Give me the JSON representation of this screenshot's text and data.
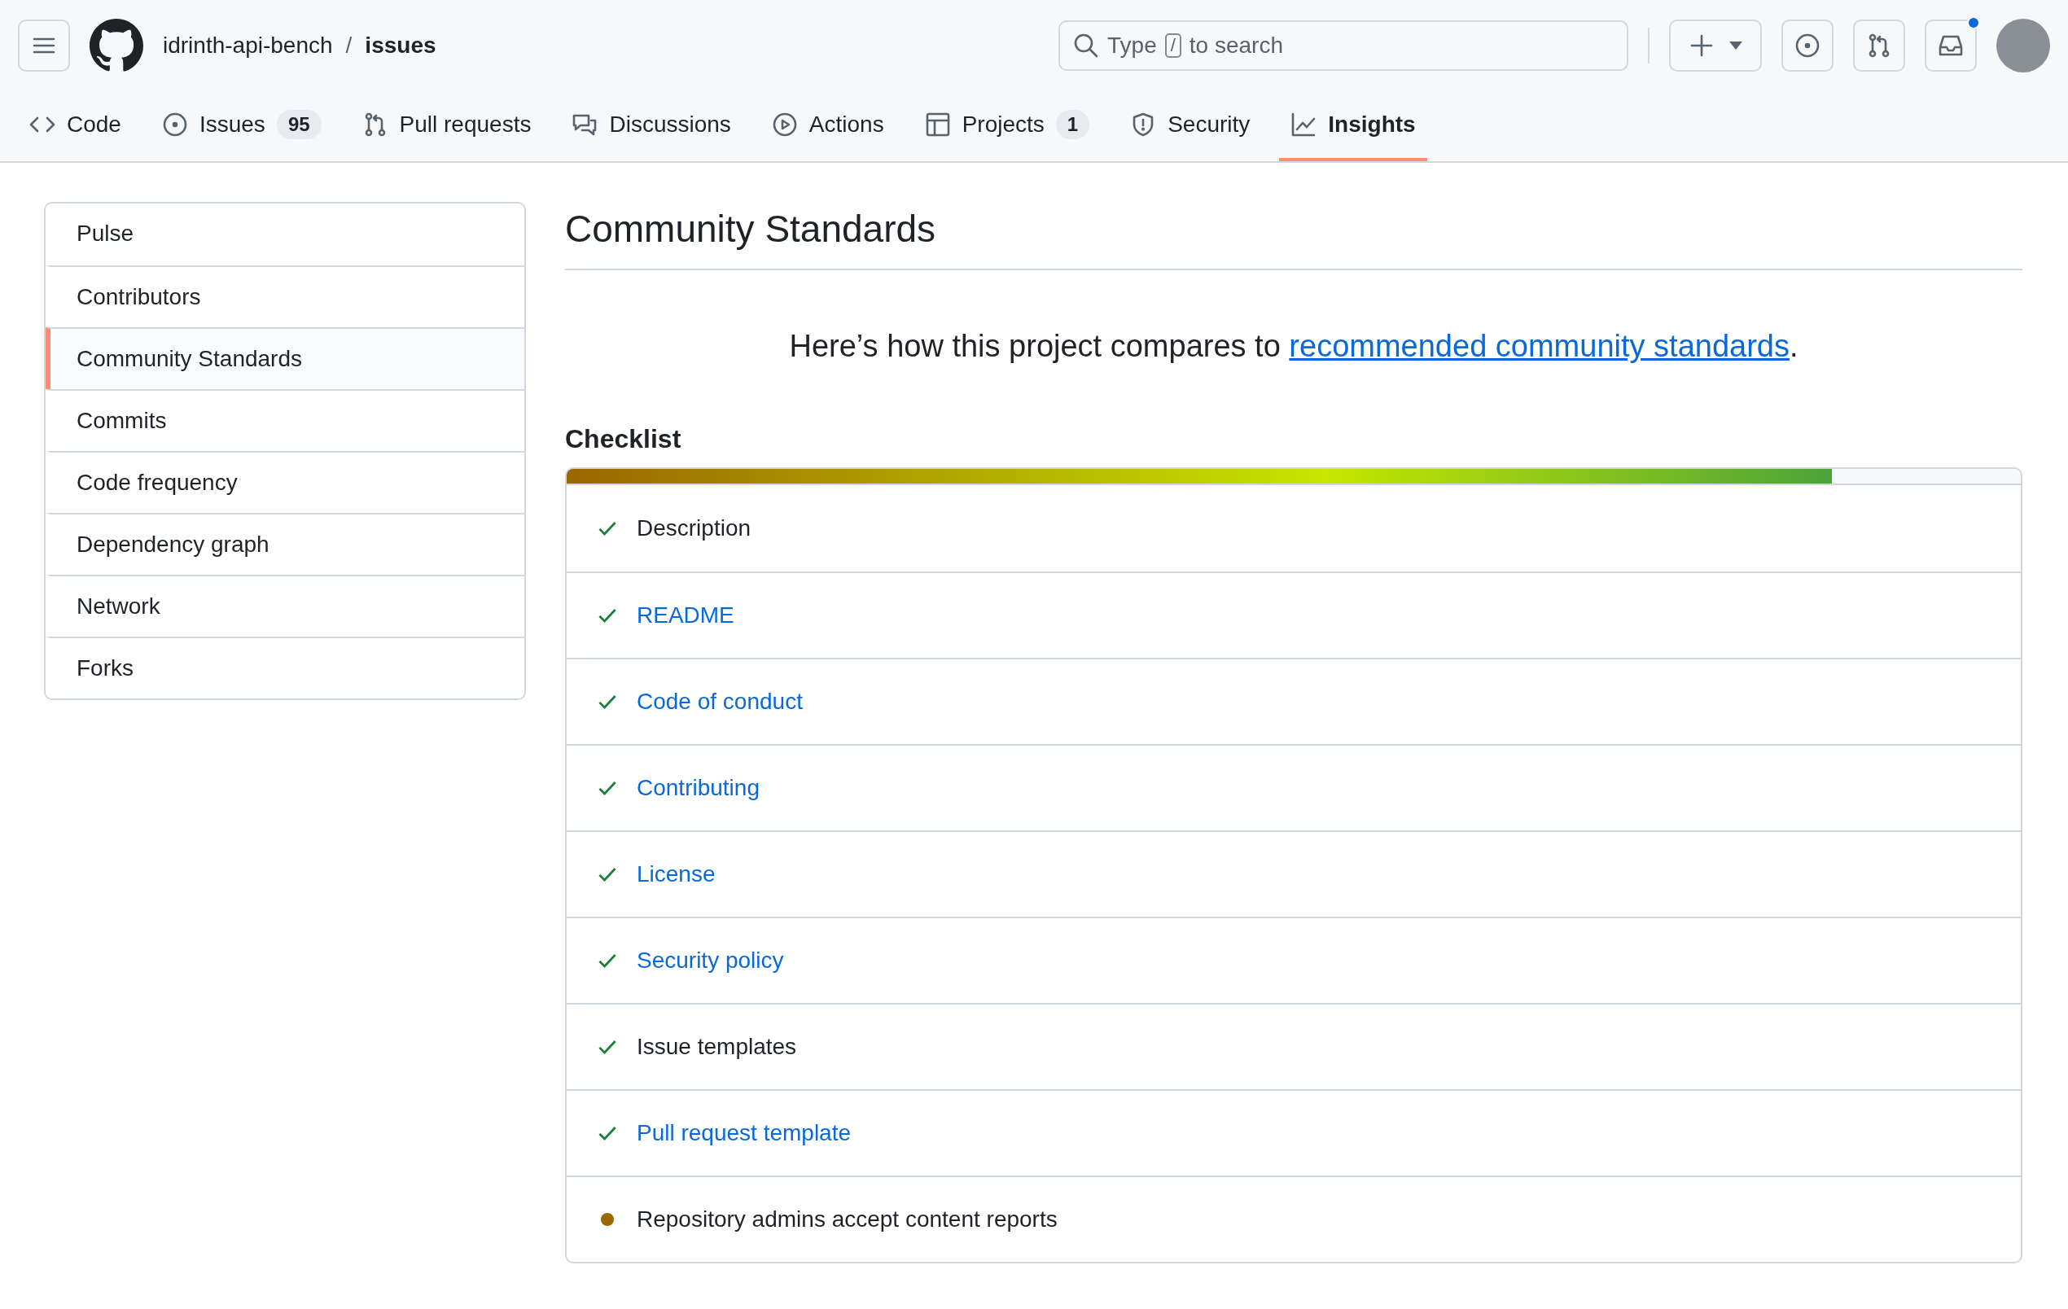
{
  "header": {
    "owner": "idrinth-api-bench",
    "separator": "/",
    "repo": "issues",
    "search_placeholder_before": "Type",
    "search_key": "/",
    "search_placeholder_after": "to search",
    "has_notifications": true
  },
  "tabs": [
    {
      "label": "Code",
      "selected": false
    },
    {
      "label": "Issues",
      "count": "95",
      "selected": false
    },
    {
      "label": "Pull requests",
      "selected": false
    },
    {
      "label": "Discussions",
      "selected": false
    },
    {
      "label": "Actions",
      "selected": false
    },
    {
      "label": "Projects",
      "count": "1",
      "selected": false
    },
    {
      "label": "Security",
      "selected": false
    },
    {
      "label": "Insights",
      "selected": true
    }
  ],
  "sidebar": {
    "items": [
      {
        "label": "Pulse",
        "selected": false
      },
      {
        "label": "Contributors",
        "selected": false
      },
      {
        "label": "Community Standards",
        "selected": true
      },
      {
        "label": "Commits",
        "selected": false
      },
      {
        "label": "Code frequency",
        "selected": false
      },
      {
        "label": "Dependency graph",
        "selected": false
      },
      {
        "label": "Network",
        "selected": false
      },
      {
        "label": "Forks",
        "selected": false
      }
    ]
  },
  "main": {
    "title": "Community Standards",
    "intro": "Here’s how this project compares to",
    "intro_link": "recommended community standards",
    "intro_end": ".",
    "checklist_title": "Checklist",
    "progress": {
      "level": 0.87
    },
    "items": [
      {
        "label": "Description",
        "done": true,
        "link": false
      },
      {
        "label": "README",
        "done": true,
        "link": true
      },
      {
        "label": "Code of conduct",
        "done": true,
        "link": true
      },
      {
        "label": "Contributing",
        "done": true,
        "link": true
      },
      {
        "label": "License",
        "done": true,
        "link": true
      },
      {
        "label": "Security policy",
        "done": true,
        "link": true
      },
      {
        "label": "Issue templates",
        "done": true,
        "link": false
      },
      {
        "label": "Pull request template",
        "done": true,
        "link": true
      },
      {
        "label": "Repository admins accept content reports",
        "done": false,
        "link": false
      }
    ]
  }
}
